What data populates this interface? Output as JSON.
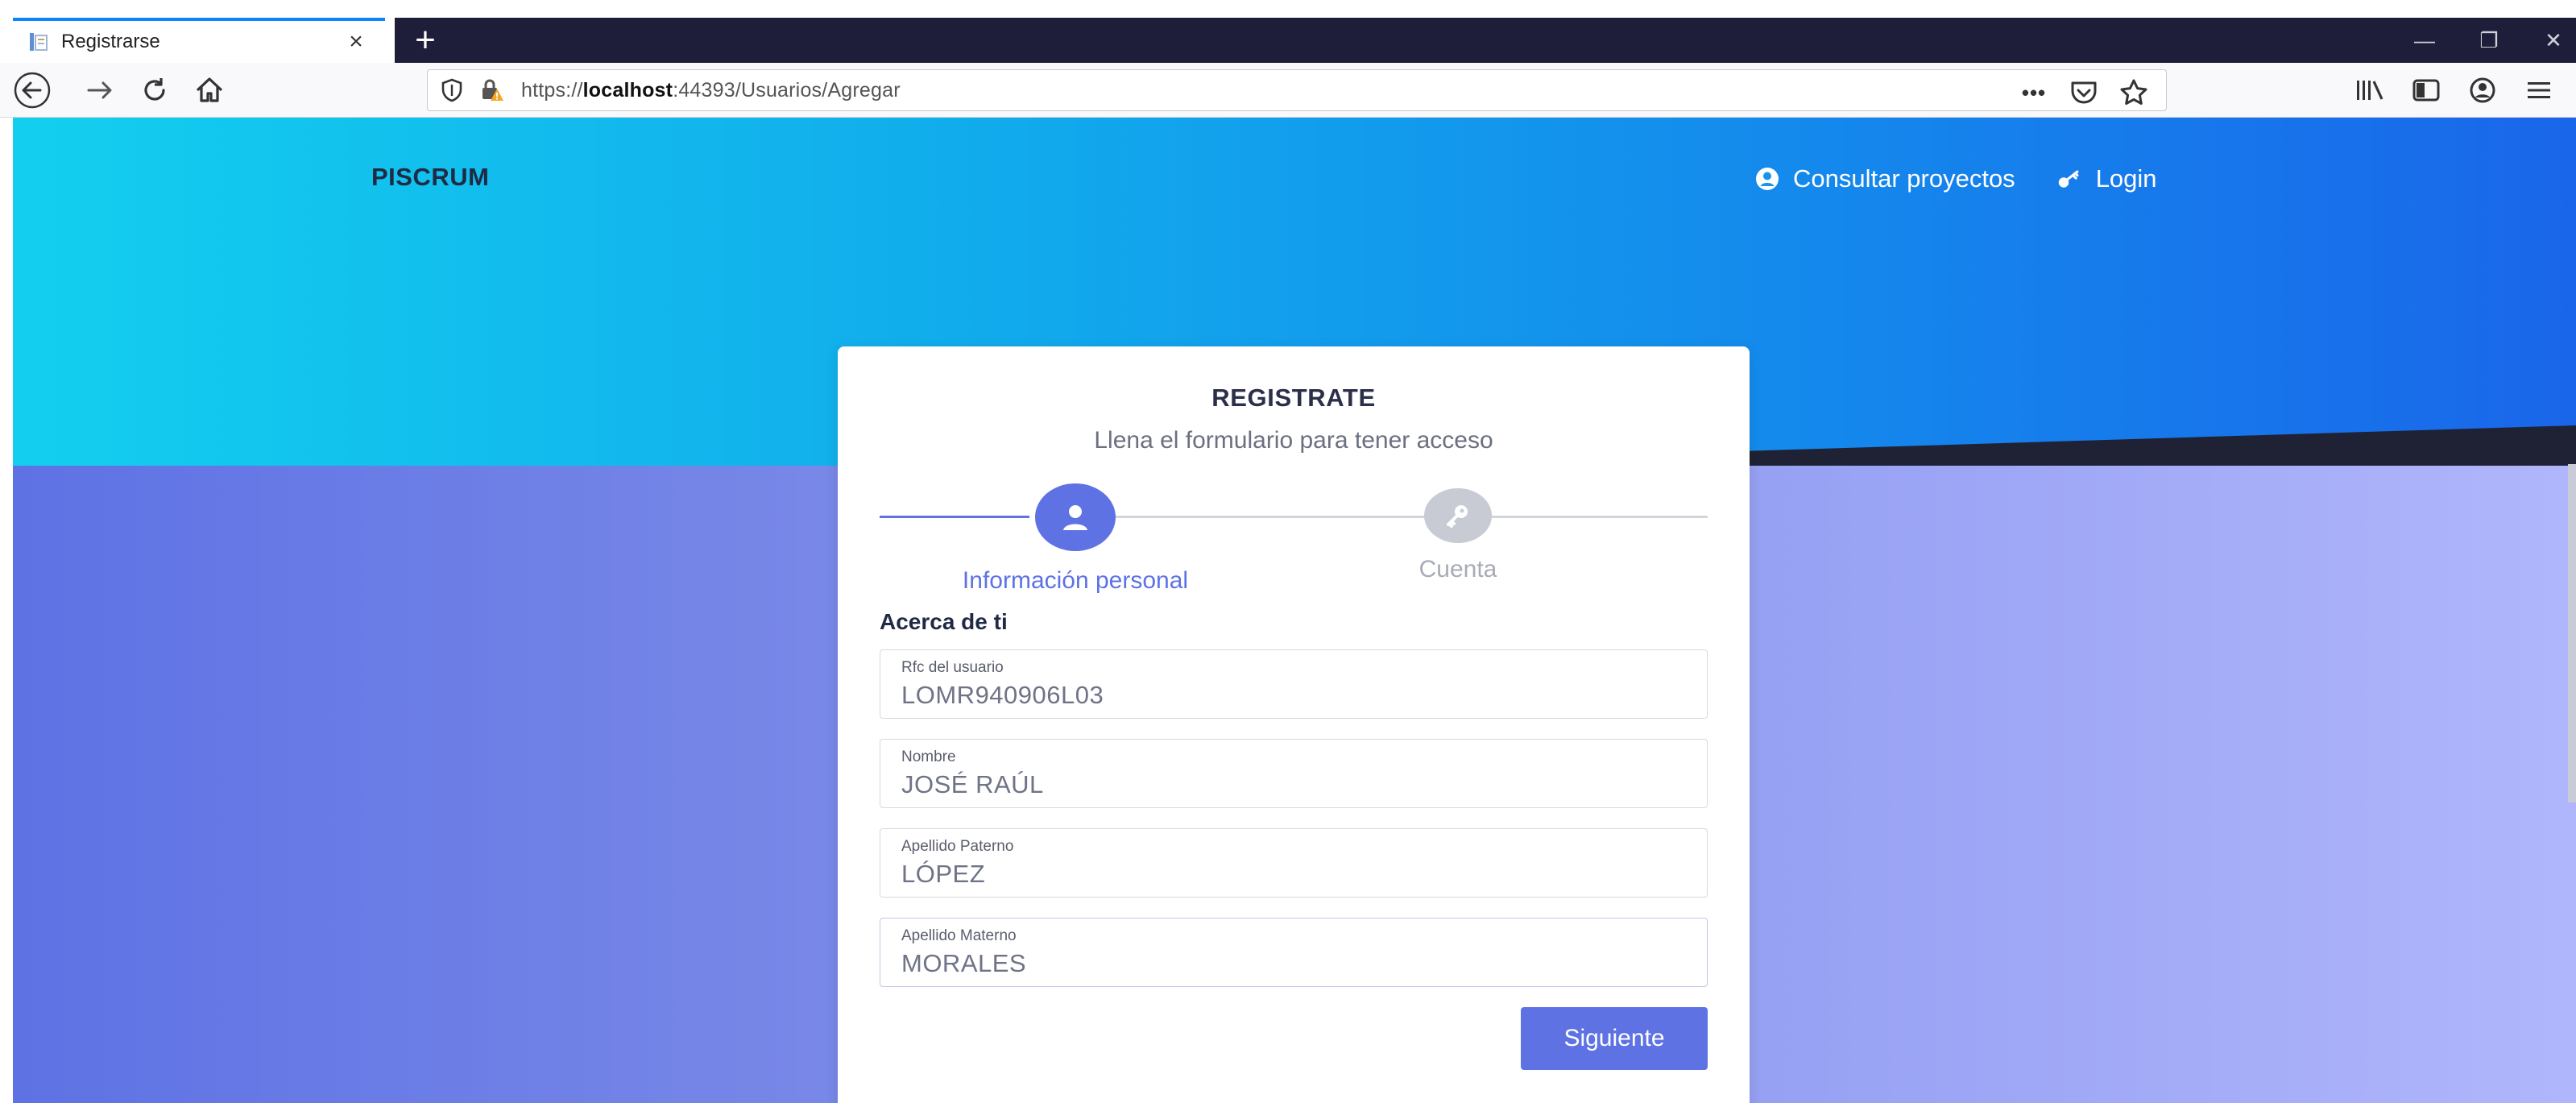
{
  "browser": {
    "tab_title": "Registrarse",
    "tab_close": "×",
    "new_tab": "+",
    "url_prefix": "https://",
    "url_host": "localhost",
    "url_path": ":44393/Usuarios/Agregar",
    "url_more": "•••",
    "window_controls": [
      "—",
      "❐",
      "✕"
    ]
  },
  "header": {
    "brand": "PISCRUM",
    "links": [
      {
        "label": "Consultar proyectos",
        "icon": "user-circle-icon"
      },
      {
        "label": "Login",
        "icon": "key-icon"
      }
    ]
  },
  "card": {
    "title": "REGISTRATE",
    "subtitle": "Llena el formulario para tener acceso",
    "steps": [
      {
        "label": "Información personal",
        "icon": "user-icon",
        "active": true
      },
      {
        "label": "Cuenta",
        "icon": "key-icon",
        "active": false
      }
    ],
    "section_title": "Acerca de ti",
    "fields": [
      {
        "label": "Rfc del usuario",
        "value": "LOMR940906L03"
      },
      {
        "label": "Nombre",
        "value": "JOSÉ RAÚL"
      },
      {
        "label": "Apellido Paterno",
        "value": "LÓPEZ"
      },
      {
        "label": "Apellido Materno",
        "value": "MORALES"
      }
    ],
    "next_button": "Siguiente"
  },
  "colors": {
    "accent": "#5e72e4",
    "hero_start": "#13cfee",
    "hero_end": "#1a66ea",
    "inactive": "#c8cbd4"
  }
}
